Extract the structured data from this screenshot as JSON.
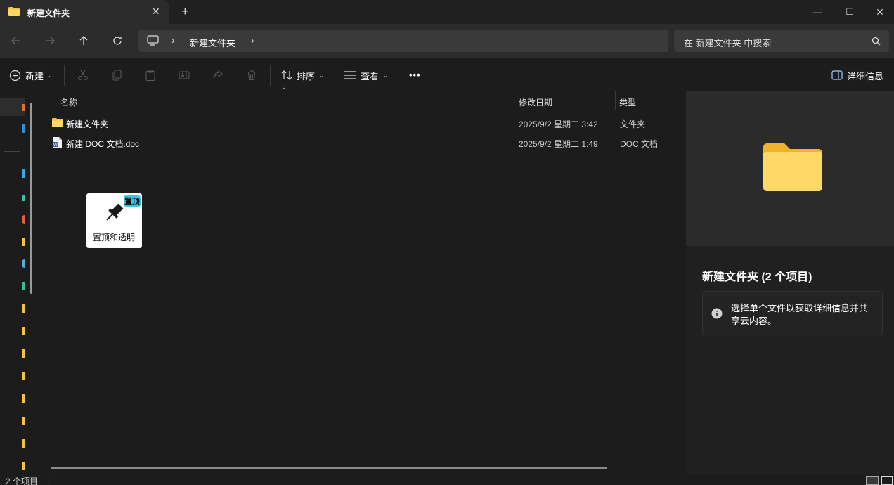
{
  "tab": {
    "title": "新建文件夹",
    "close": "✕",
    "new_tab": "+"
  },
  "window": {
    "minimize": "—",
    "maximize": "☐",
    "close": "✕"
  },
  "breadcrumb": {
    "folder": "新建文件夹",
    "sep": "›"
  },
  "search": {
    "placeholder": "在 新建文件夹 中搜索"
  },
  "toolbar": {
    "new_label": "新建",
    "sort_label": "排序",
    "view_label": "查看",
    "more_label": "•••",
    "details_label": "详细信息"
  },
  "columns": {
    "name": "名称",
    "modified": "修改日期",
    "type": "类型"
  },
  "files": [
    {
      "name": "新建文件夹",
      "modified": "2025/9/2 星期二  3:42",
      "type": "文件夹",
      "icon": "folder-icon"
    },
    {
      "name": "新建 DOC 文档.doc",
      "modified": "2025/9/2 星期二  1:49",
      "type": "DOC 文档",
      "icon": "word-doc-icon"
    }
  ],
  "details": {
    "title": "新建文件夹 (2 个项目)",
    "info": "选择单个文件以获取详细信息并共享云内容。"
  },
  "pin_widget": {
    "label": "置顶和透明",
    "badge": "置顶"
  },
  "status": {
    "count": "2 个项目"
  },
  "colors": {
    "accent": "#38c8e6",
    "folder": "#f5c342",
    "background": "#1c1c1c"
  }
}
